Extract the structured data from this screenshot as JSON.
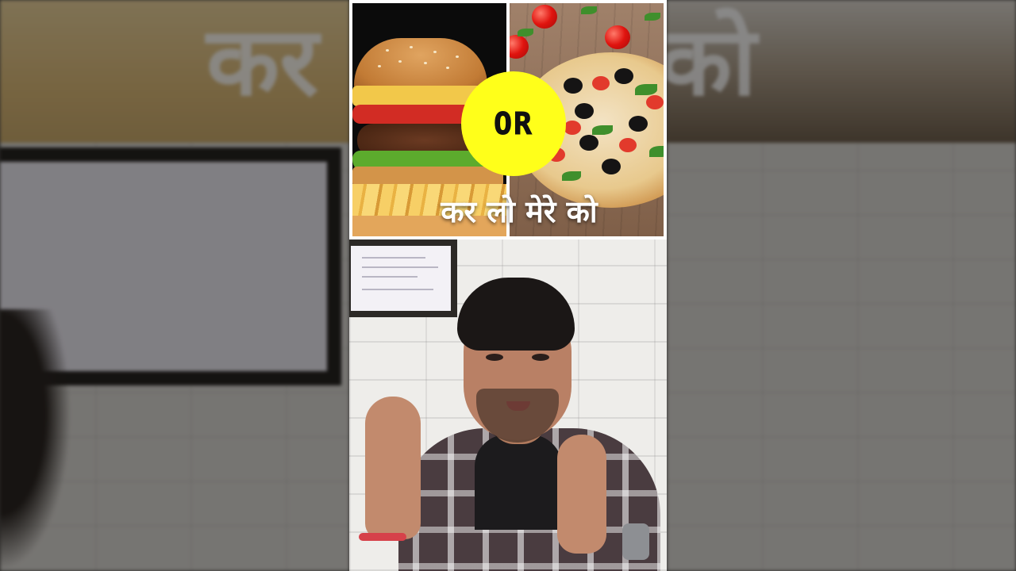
{
  "overlay": {
    "badge_text": "OR",
    "caption": "कर लो मेरे को"
  },
  "background": {
    "left_text": "कर",
    "right_text": "को"
  },
  "colors": {
    "badge_fill": "#ffff1a",
    "caption_text": "#ffffff",
    "page_background": "#2b2a28"
  },
  "icons": {
    "left_panel": "burger-image",
    "right_panel": "pizza-image"
  }
}
